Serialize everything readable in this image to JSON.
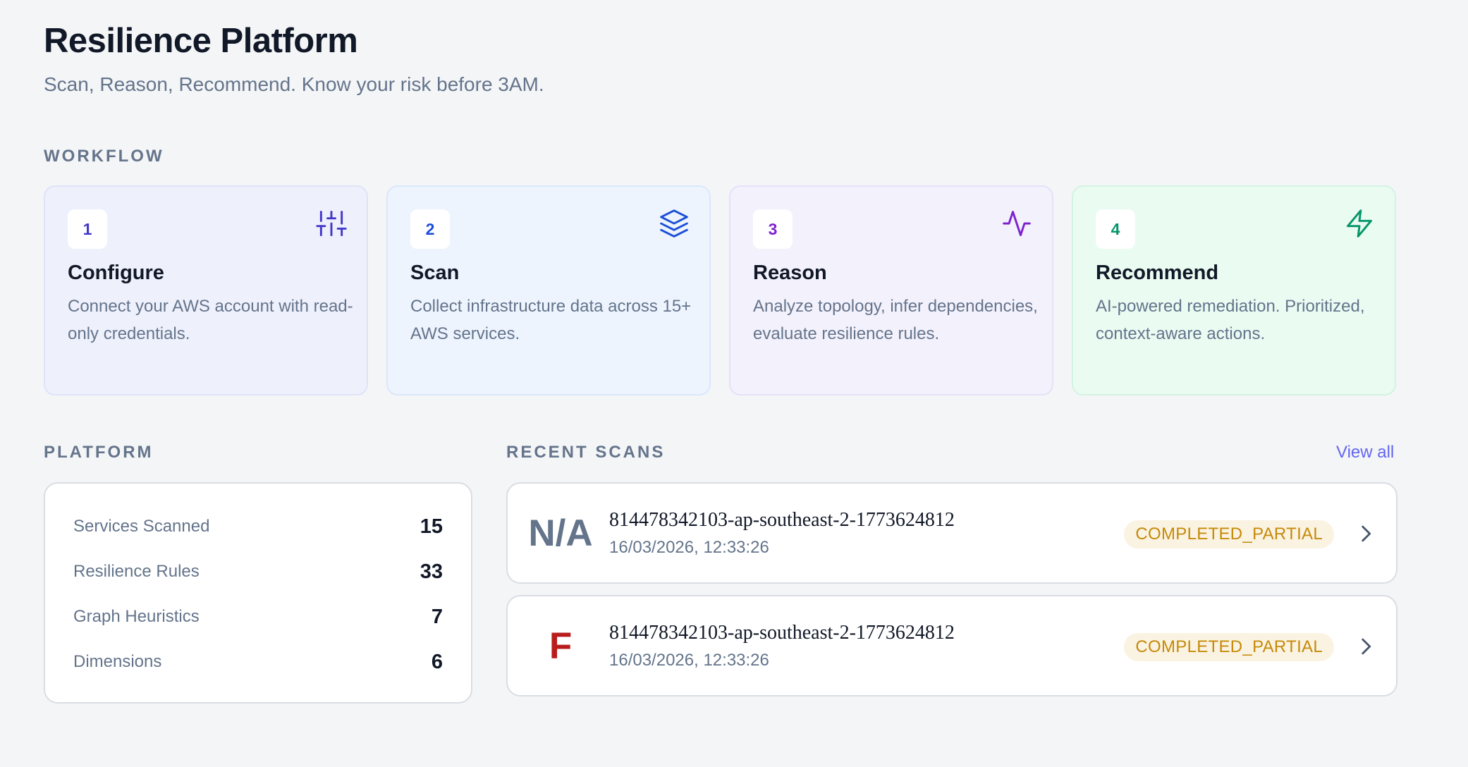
{
  "header": {
    "title": "Resilience Platform",
    "subtitle": "Scan, Reason, Recommend. Know your risk before 3AM."
  },
  "workflow": {
    "label": "WORKFLOW",
    "steps": [
      {
        "number": "1",
        "title": "Configure",
        "description": "Connect your AWS account with read-only credentials.",
        "icon": "sliders-icon",
        "accent": "#4338ca"
      },
      {
        "number": "2",
        "title": "Scan",
        "description": "Collect infrastructure data across 15+ AWS services.",
        "icon": "layers-icon",
        "accent": "#1d4ed8"
      },
      {
        "number": "3",
        "title": "Reason",
        "description": "Analyze topology, infer dependencies, evaluate resilience rules.",
        "icon": "activity-icon",
        "accent": "#7e22ce"
      },
      {
        "number": "4",
        "title": "Recommend",
        "description": "AI-powered remediation. Prioritized, context-aware actions.",
        "icon": "zap-icon",
        "accent": "#059669"
      }
    ]
  },
  "platform": {
    "label": "PLATFORM",
    "stats": [
      {
        "label": "Services Scanned",
        "value": "15"
      },
      {
        "label": "Resilience Rules",
        "value": "33"
      },
      {
        "label": "Graph Heuristics",
        "value": "7"
      },
      {
        "label": "Dimensions",
        "value": "6"
      }
    ]
  },
  "recent_scans": {
    "label": "RECENT SCANS",
    "view_all": "View all",
    "items": [
      {
        "grade": "N/A",
        "id": "814478342103-ap-southeast-2-1773624812",
        "timestamp": "16/03/2026, 12:33:26",
        "status": "COMPLETED_PARTIAL",
        "grade_color": "#64748b"
      },
      {
        "grade": "F",
        "id": "814478342103-ap-southeast-2-1773624812",
        "timestamp": "16/03/2026, 12:33:26",
        "status": "COMPLETED_PARTIAL",
        "grade_color": "#b91c1c"
      }
    ]
  }
}
